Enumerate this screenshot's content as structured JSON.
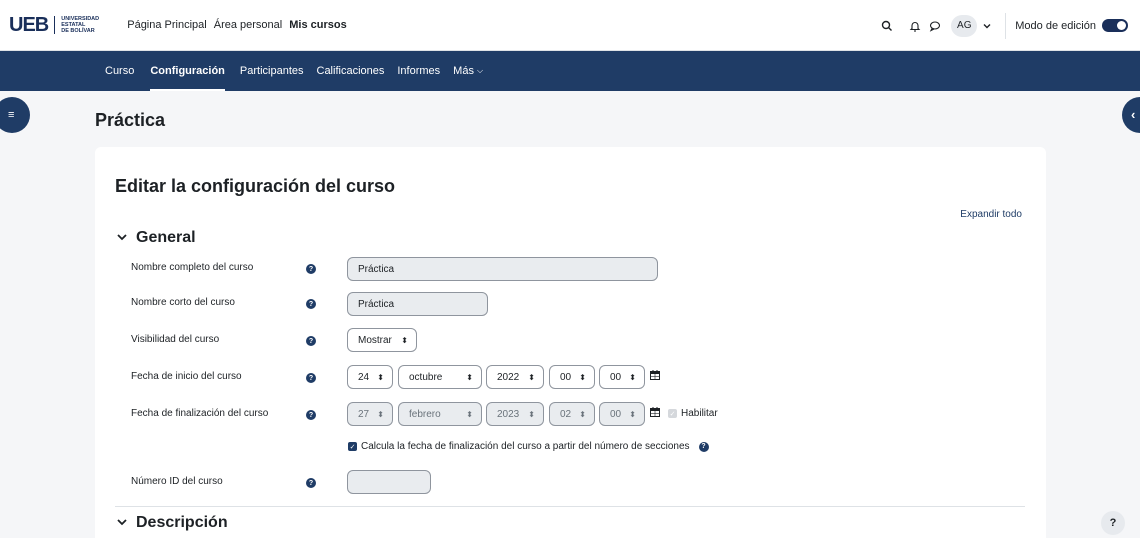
{
  "brand": {
    "logo_text": "UEB",
    "university_line1": "UNIVERSIDAD",
    "university_line2": "ESTATAL",
    "university_line3": "DE BOLÍVAR"
  },
  "main_nav": {
    "home": "Página Principal",
    "personal": "Área personal",
    "courses": "Mis cursos"
  },
  "user": {
    "initials": "AG",
    "edit_mode_label": "Modo de edición"
  },
  "course_nav": {
    "course": "Curso",
    "settings": "Configuración",
    "participants": "Participantes",
    "grades": "Calificaciones",
    "reports": "Informes",
    "more": "Más"
  },
  "page": {
    "title": "Práctica"
  },
  "form": {
    "title": "Editar la configuración del curso",
    "expand_all": "Expandir todo",
    "section_general": "General",
    "section_description": "Descripción",
    "full_name_label": "Nombre completo del curso",
    "full_name_value": "Práctica",
    "short_name_label": "Nombre corto del curso",
    "short_name_value": "Práctica",
    "visibility_label": "Visibilidad del curso",
    "visibility_value": "Mostrar",
    "start_date_label": "Fecha de inicio del curso",
    "start": {
      "day": "24",
      "month": "octubre",
      "year": "2022",
      "hour": "00",
      "minute": "00"
    },
    "end_date_label": "Fecha de finalización del curso",
    "end": {
      "day": "27",
      "month": "febrero",
      "year": "2023",
      "hour": "02",
      "minute": "00"
    },
    "enable_label": "Habilitar",
    "calc_label": "Calcula la fecha de finalización del curso a partir del número de secciones",
    "id_label": "Número ID del curso",
    "id_value": ""
  },
  "help_button": "?"
}
